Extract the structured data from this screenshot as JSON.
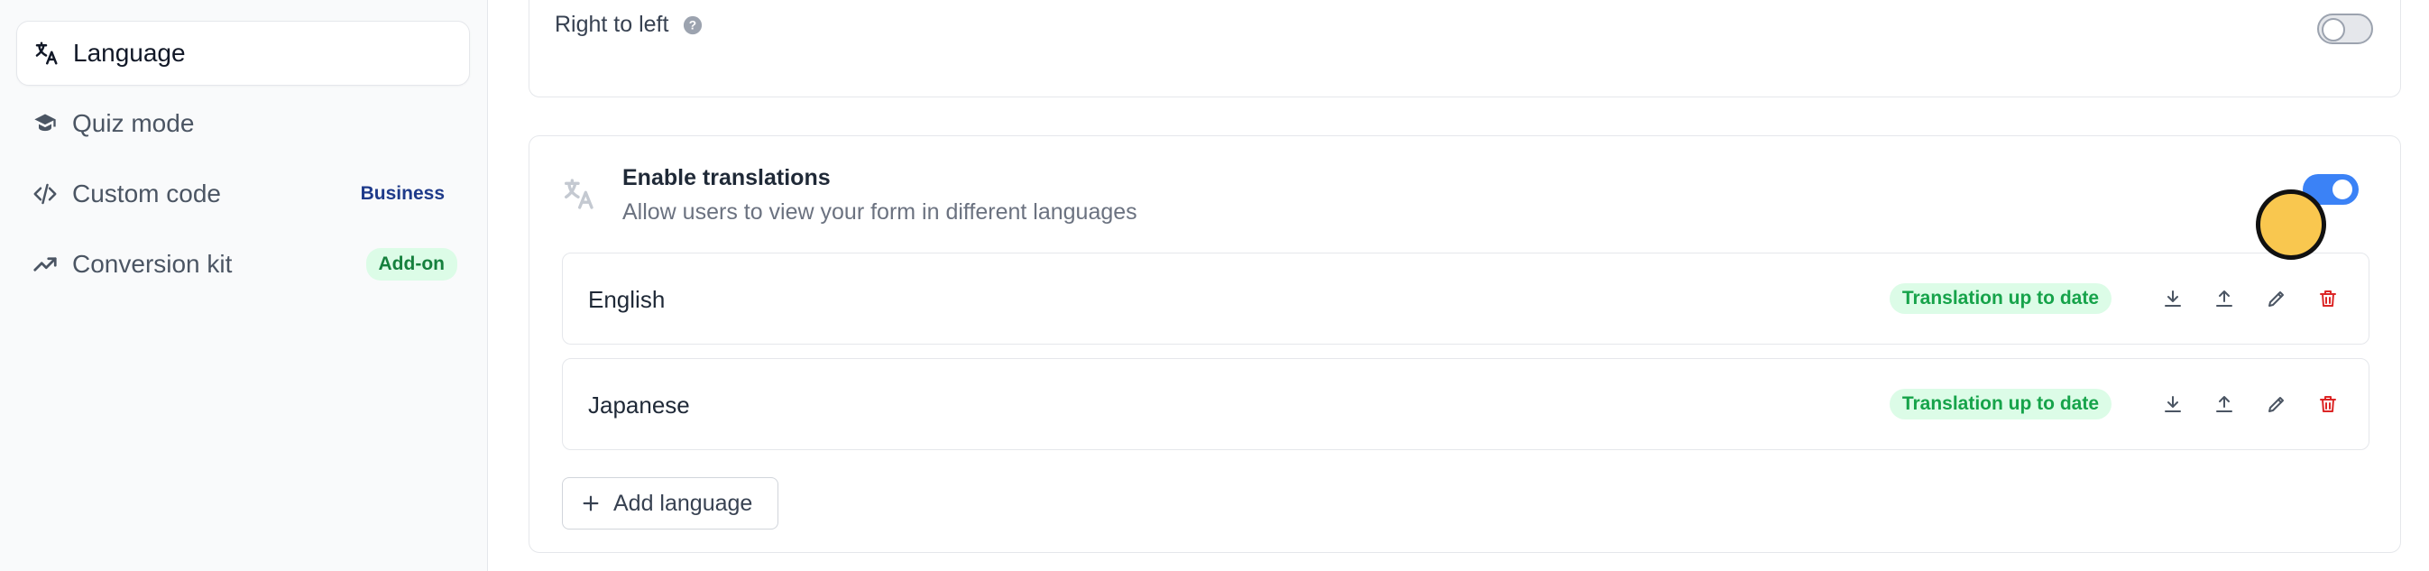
{
  "sidebar": {
    "items": [
      {
        "label": "Language",
        "icon": "translate-icon",
        "active": true
      },
      {
        "label": "Quiz mode",
        "icon": "graduation-cap-icon"
      },
      {
        "label": "Custom code",
        "icon": "code-icon",
        "badge": "Business"
      },
      {
        "label": "Conversion kit",
        "icon": "trending-up-icon",
        "badge": "Add-on"
      }
    ]
  },
  "rtl": {
    "label": "Right to left",
    "help_icon": "question-circle-icon",
    "enabled": false
  },
  "translations": {
    "title": "Enable translations",
    "subtitle": "Allow users to view your form in different languages",
    "enabled": true,
    "languages": [
      {
        "name": "English",
        "status": "Translation up to date"
      },
      {
        "name": "Japanese",
        "status": "Translation up to date"
      }
    ],
    "add_label": "Add language"
  },
  "colors": {
    "accent": "#3b82f6",
    "success": "#16a34a",
    "danger": "#dc2626",
    "cursor": "#f9c74f"
  }
}
